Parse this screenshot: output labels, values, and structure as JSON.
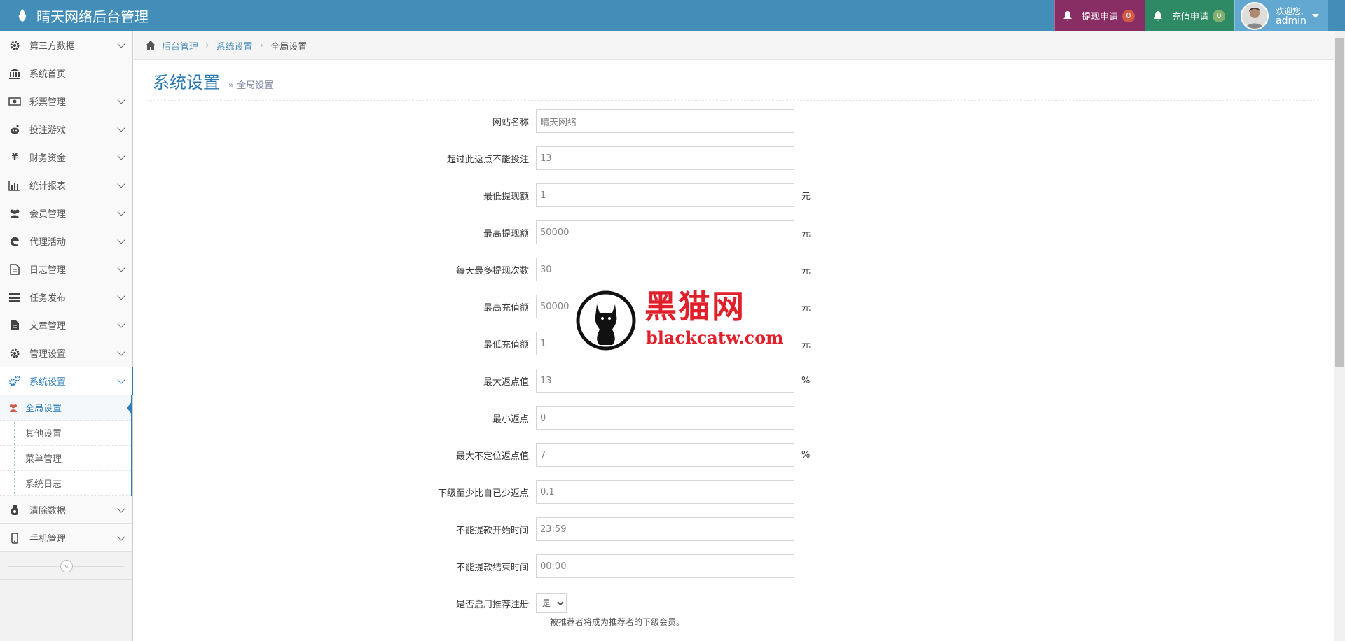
{
  "app": {
    "title": "晴天网络后台管理"
  },
  "topnav": {
    "withdraw_label": "提现申请",
    "withdraw_count": "0",
    "recharge_label": "充值申请",
    "recharge_count": "0",
    "welcome": "欢迎您,",
    "username": "admin"
  },
  "sidebar": {
    "items": [
      {
        "label": "第三方数据",
        "icon": "gear-icon"
      },
      {
        "label": "系统首页",
        "icon": "bank-icon"
      },
      {
        "label": "彩票管理",
        "icon": "money-icon"
      },
      {
        "label": "投注游戏",
        "icon": "reddit-icon"
      },
      {
        "label": "财务资金",
        "icon": "yen-icon"
      },
      {
        "label": "统计报表",
        "icon": "bar-chart-icon"
      },
      {
        "label": "会员管理",
        "icon": "users-icon"
      },
      {
        "label": "代理活动",
        "icon": "edge-icon"
      },
      {
        "label": "日志管理",
        "icon": "file-icon"
      },
      {
        "label": "任务发布",
        "icon": "tasks-icon"
      },
      {
        "label": "文章管理",
        "icon": "document-icon"
      },
      {
        "label": "管理设置",
        "icon": "gear-icon"
      },
      {
        "label": "系统设置",
        "icon": "gears-icon"
      },
      {
        "label": "清除数据",
        "icon": "sanitizer-icon"
      },
      {
        "label": "手机管理",
        "icon": "mobile-icon"
      }
    ],
    "submenu": [
      "全局设置",
      "其他设置",
      "菜单管理",
      "系统日志"
    ],
    "collapse": "«"
  },
  "breadcrumb": {
    "home": "后台管理",
    "section": "系统设置",
    "current": "全局设置"
  },
  "page": {
    "title": "系统设置",
    "subtitle": "» 全局设置"
  },
  "form": {
    "fields": [
      {
        "label": "网站名称",
        "value": "晴天网络",
        "unit": ""
      },
      {
        "label": "超过此返点不能投注",
        "value": "13",
        "unit": ""
      },
      {
        "label": "最低提现额",
        "value": "1",
        "unit": "元"
      },
      {
        "label": "最高提现额",
        "value": "50000",
        "unit": "元"
      },
      {
        "label": "每天最多提现次数",
        "value": "30",
        "unit": "元"
      },
      {
        "label": "最高充值额",
        "value": "50000",
        "unit": "元"
      },
      {
        "label": "最低充值额",
        "value": "1",
        "unit": "元"
      },
      {
        "label": "最大返点值",
        "value": "13",
        "unit": "%"
      },
      {
        "label": "最小返点",
        "value": "0",
        "unit": ""
      },
      {
        "label": "最大不定位返点值",
        "value": "7",
        "unit": "%"
      },
      {
        "label": "下级至少比自已少返点",
        "value": "0.1",
        "unit": ""
      },
      {
        "label": "不能提款开始时间",
        "value": "23:59",
        "unit": ""
      },
      {
        "label": "不能提款结束时间",
        "value": "00:00",
        "unit": ""
      }
    ],
    "referral_label": "是否启用推荐注册",
    "referral_value": "是",
    "referral_help": "被推荐者将成为推荐者的下级会员。"
  },
  "watermark": {
    "cn": "黑猫网",
    "en": "blackcatw.com"
  },
  "colors": {
    "navbar": "#438eb9",
    "withdraw": "#892e65",
    "recharge": "#2e8965",
    "user": "#62a8d1",
    "accent": "#2b7dbc",
    "watermark": "#e0202a"
  }
}
